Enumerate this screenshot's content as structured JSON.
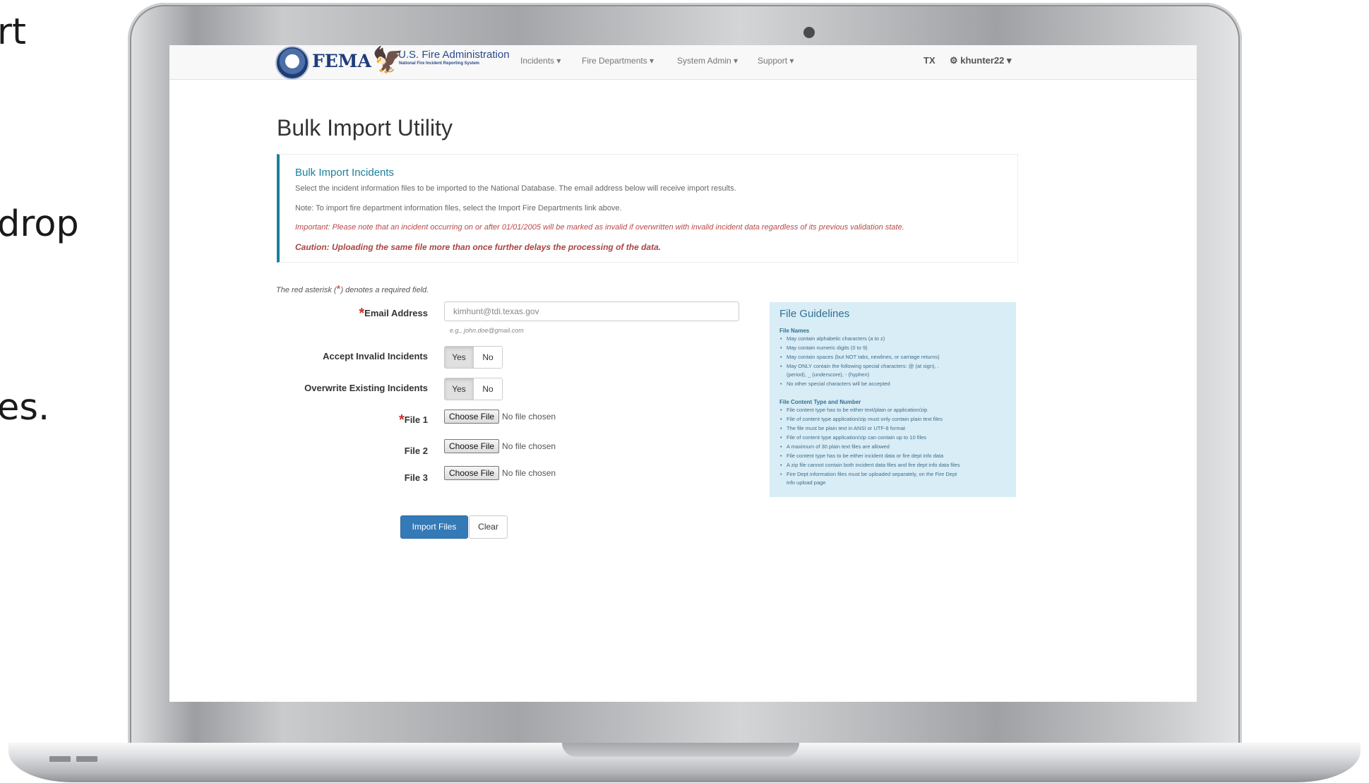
{
  "slide_fragments": [
    "rt",
    "drop",
    "es."
  ],
  "nav": {
    "brand_fema": "FEMA",
    "brand_usfa": "U.S. Fire Administration",
    "brand_usfa_sub": "National Fire Incident Reporting System",
    "menu": [
      "Incidents ▾",
      "Fire Departments ▾",
      "System Admin ▾",
      "Support ▾"
    ],
    "state": "TX",
    "user": "⚙ khunter22 ▾"
  },
  "page": {
    "title": "Bulk Import Utility"
  },
  "info": {
    "title": "Bulk Import Incidents",
    "line1": "Select the incident information files to be imported to the National Database. The email address below will receive import results.",
    "line2": "Note: To import fire department information files, select the Import Fire Departments link above.",
    "important": "Important: Please note that an incident occurring on or after 01/01/2005 will be marked as invalid if overwritten with invalid incident data regardless of its previous validation state.",
    "caution": "Caution: Uploading the same file more than once further delays the processing of the data."
  },
  "form": {
    "required_prefix": "The red asterisk (",
    "required_star": "*",
    "required_suffix": ") denotes a required field.",
    "email_label": "Email Address",
    "email_value": "kimhunt@tdi.texas.gov",
    "email_hint": "e.g., john.doe@gmail.com",
    "accept_label": "Accept Invalid Incidents",
    "overwrite_label": "Overwrite Existing Incidents",
    "yes": "Yes",
    "no": "No",
    "file1_label": "File 1",
    "file2_label": "File 2",
    "file3_label": "File 3",
    "choose_file": "Choose File",
    "no_file": "No file chosen",
    "import_button": "Import Files",
    "clear_button": "Clear"
  },
  "guidelines": {
    "title": "File Guidelines",
    "names_heading": "File Names",
    "names": [
      "May contain alphabetic characters (a to z)",
      "May contain numeric digits (0 to 9)",
      "May contain spaces (but NOT tabs, newlines, or carriage returns)",
      "May ONLY contain the following special characters: @ (at sign), .",
      "(period), _ (underscore), - (hyphen)",
      "No other special characters will be accepted"
    ],
    "content_heading": "File Content Type and Number",
    "content": [
      "File content type has to be either text/plain or application/zip",
      "File of content type application/zip must only contain plain text files",
      "The file must be plain text in ANSI or UTF-8 format",
      "File of content type application/zip can contain up to 10 files",
      "A maximum of 30 plain text files are allowed",
      "File content type has to be either incident data or fire dept info data",
      "A zip file cannot contain both incident data files and fire dept info data files",
      "Fire Dept information files must be uploaded separately, on the Fire Dept",
      "info upload page"
    ]
  }
}
